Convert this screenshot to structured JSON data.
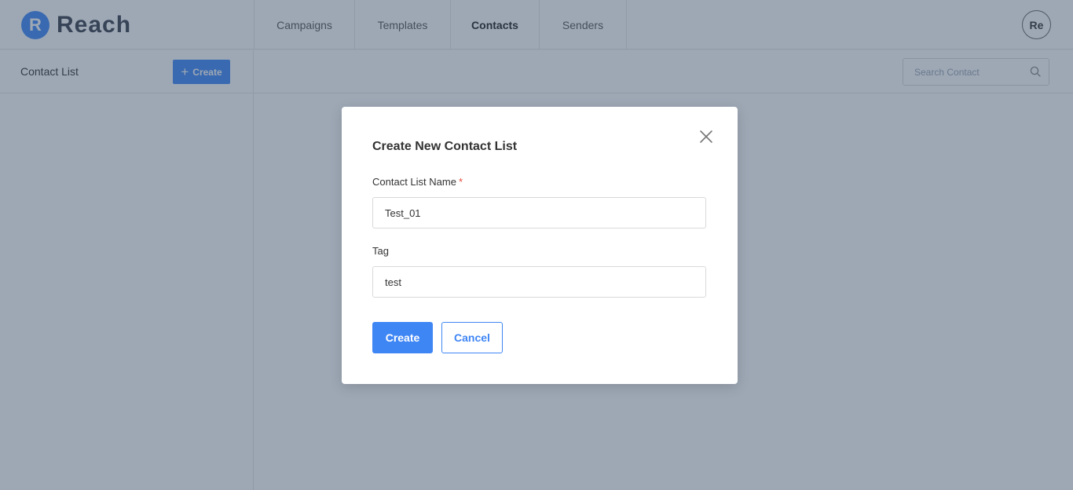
{
  "app": {
    "logo_letter": "R",
    "name": "Reach",
    "accent_color": "#3f86f5"
  },
  "nav": {
    "tabs": [
      {
        "label": "Campaigns",
        "active": false
      },
      {
        "label": "Templates",
        "active": false
      },
      {
        "label": "Contacts",
        "active": true
      },
      {
        "label": "Senders",
        "active": false
      }
    ]
  },
  "user": {
    "avatar_initials": "Re"
  },
  "sidebar": {
    "title": "Contact List",
    "create_label": "Create",
    "create_icon": "plus-icon"
  },
  "search": {
    "placeholder": "Search Contact",
    "value": "",
    "icon": "search-icon"
  },
  "modal": {
    "title": "Create New Contact List",
    "close_icon": "close-icon",
    "fields": {
      "name": {
        "label": "Contact List Name",
        "required_mark": "*",
        "value": "Test_01"
      },
      "tag": {
        "label": "Tag",
        "value": "test"
      }
    },
    "buttons": {
      "create_label": "Create",
      "cancel_label": "Cancel"
    }
  }
}
